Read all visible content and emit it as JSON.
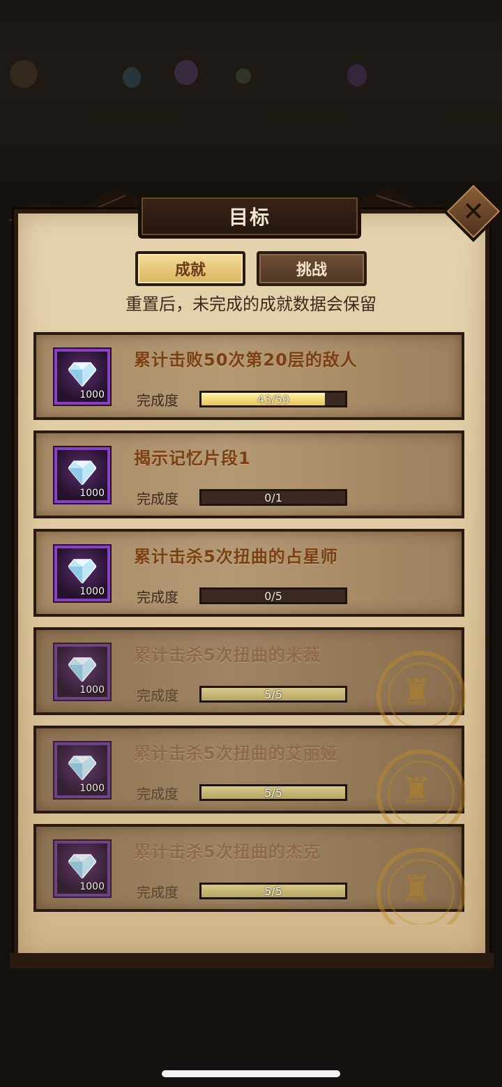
{
  "header": {
    "title": "目标",
    "close_icon": "close-icon"
  },
  "tabs": [
    {
      "label": "成就",
      "active": true
    },
    {
      "label": "挑战",
      "active": false
    }
  ],
  "subtitle": "重置后，未完成的成就数据会保留",
  "progress_label": "完成度",
  "achievements": [
    {
      "title": "累计击败50次第20层的敌人",
      "reward_icon": "diamond-icon",
      "reward_count": "1000",
      "progress_text": "43/50",
      "progress": 0.86,
      "completed": false
    },
    {
      "title": "揭示记忆片段1",
      "reward_icon": "diamond-icon",
      "reward_count": "1000",
      "progress_text": "0/1",
      "progress": 0,
      "completed": false
    },
    {
      "title": "累计击杀5次扭曲的占星师",
      "reward_icon": "diamond-icon",
      "reward_count": "1000",
      "progress_text": "0/5",
      "progress": 0,
      "completed": false
    },
    {
      "title": "累计击杀5次扭曲的米薇",
      "reward_icon": "diamond-icon",
      "reward_count": "1000",
      "progress_text": "5/5",
      "progress": 1,
      "completed": true
    },
    {
      "title": "累计击杀5次扭曲的艾丽娅",
      "reward_icon": "diamond-icon",
      "reward_count": "1000",
      "progress_text": "5/5",
      "progress": 1,
      "completed": true
    },
    {
      "title": "累计击杀5次扭曲的杰克",
      "reward_icon": "diamond-icon",
      "reward_count": "1000",
      "progress_text": "5/5",
      "progress": 1,
      "completed": true
    }
  ],
  "colors": {
    "accent_gold": "#e7c659",
    "reward_frame": "#8b3fc4",
    "title_brown": "#7a3f12"
  }
}
